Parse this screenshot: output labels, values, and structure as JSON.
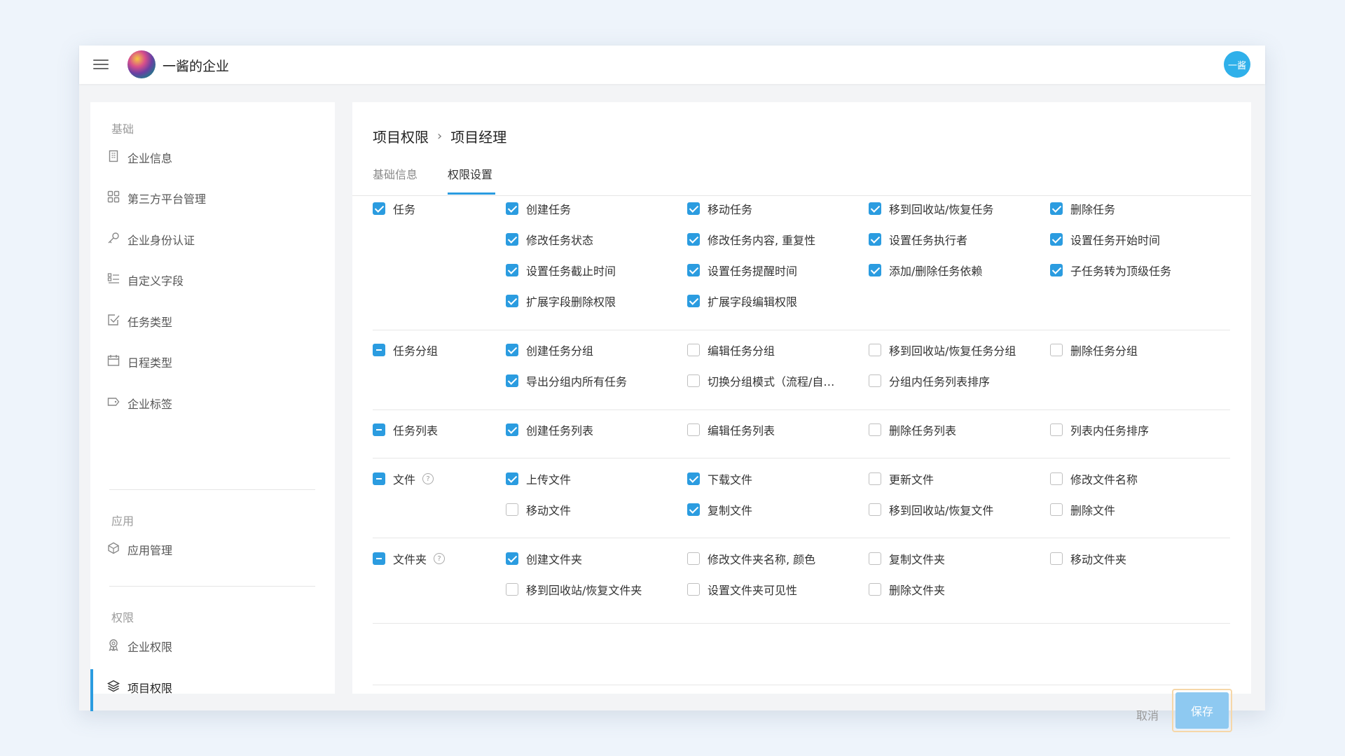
{
  "header": {
    "company_name": "一酱的企业",
    "avatar_text": "一酱"
  },
  "sidebar": {
    "sections": [
      {
        "title": "基础",
        "items": [
          {
            "label": "企业信息",
            "icon": "building-icon"
          },
          {
            "label": "第三方平台管理",
            "icon": "grid-icon"
          },
          {
            "label": "企业身份认证",
            "icon": "key-icon"
          },
          {
            "label": "自定义字段",
            "icon": "list-icon"
          },
          {
            "label": "任务类型",
            "icon": "checkbox-icon"
          },
          {
            "label": "日程类型",
            "icon": "calendar-icon"
          },
          {
            "label": "企业标签",
            "icon": "tag-icon"
          }
        ]
      },
      {
        "title": "应用",
        "items": [
          {
            "label": "应用管理",
            "icon": "cube-icon"
          }
        ]
      },
      {
        "title": "权限",
        "items": [
          {
            "label": "企业权限",
            "icon": "badge-icon"
          },
          {
            "label": "项目权限",
            "icon": "layers-icon",
            "active": true
          }
        ]
      }
    ]
  },
  "main": {
    "breadcrumb": [
      "项目权限",
      "项目经理"
    ],
    "tabs": [
      {
        "label": "基础信息",
        "active": false
      },
      {
        "label": "权限设置",
        "active": true
      }
    ],
    "groups": [
      {
        "name": "任务",
        "state": "checked",
        "help": false,
        "items": [
          {
            "label": "创建任务",
            "checked": true
          },
          {
            "label": "移动任务",
            "checked": true
          },
          {
            "label": "移到回收站/恢复任务",
            "checked": true
          },
          {
            "label": "删除任务",
            "checked": true
          },
          {
            "label": "修改任务状态",
            "checked": true
          },
          {
            "label": "修改任务内容, 重复性",
            "checked": true
          },
          {
            "label": "设置任务执行者",
            "checked": true
          },
          {
            "label": "设置任务开始时间",
            "checked": true
          },
          {
            "label": "设置任务截止时间",
            "checked": true
          },
          {
            "label": "设置任务提醒时间",
            "checked": true
          },
          {
            "label": "添加/删除任务依赖",
            "checked": true
          },
          {
            "label": "子任务转为顶级任务",
            "checked": true
          },
          {
            "label": "扩展字段删除权限",
            "checked": true
          },
          {
            "label": "扩展字段编辑权限",
            "checked": true
          }
        ]
      },
      {
        "name": "任务分组",
        "state": "indeterminate",
        "help": false,
        "items": [
          {
            "label": "创建任务分组",
            "checked": true
          },
          {
            "label": "编辑任务分组",
            "checked": false
          },
          {
            "label": "移到回收站/恢复任务分组",
            "checked": false
          },
          {
            "label": "删除任务分组",
            "checked": false
          },
          {
            "label": "导出分组内所有任务",
            "checked": true
          },
          {
            "label": "切换分组模式（流程/自…",
            "checked": false
          },
          {
            "label": "分组内任务列表排序",
            "checked": false
          }
        ]
      },
      {
        "name": "任务列表",
        "state": "indeterminate",
        "help": false,
        "items": [
          {
            "label": "创建任务列表",
            "checked": true
          },
          {
            "label": "编辑任务列表",
            "checked": false
          },
          {
            "label": "删除任务列表",
            "checked": false
          },
          {
            "label": "列表内任务排序",
            "checked": false
          }
        ]
      },
      {
        "name": "文件",
        "state": "indeterminate",
        "help": true,
        "items": [
          {
            "label": "上传文件",
            "checked": true
          },
          {
            "label": "下载文件",
            "checked": true
          },
          {
            "label": "更新文件",
            "checked": false
          },
          {
            "label": "修改文件名称",
            "checked": false
          },
          {
            "label": "移动文件",
            "checked": false
          },
          {
            "label": "复制文件",
            "checked": true
          },
          {
            "label": "移到回收站/恢复文件",
            "checked": false
          },
          {
            "label": "删除文件",
            "checked": false
          }
        ]
      },
      {
        "name": "文件夹",
        "state": "indeterminate",
        "help": true,
        "items": [
          {
            "label": "创建文件夹",
            "checked": true
          },
          {
            "label": "修改文件夹名称, 颜色",
            "checked": false
          },
          {
            "label": "复制文件夹",
            "checked": false
          },
          {
            "label": "移动文件夹",
            "checked": false
          },
          {
            "label": "移到回收站/恢复文件夹",
            "checked": false
          },
          {
            "label": "设置文件夹可见性",
            "checked": false
          },
          {
            "label": "删除文件夹",
            "checked": false
          }
        ]
      }
    ],
    "actions": {
      "cancel_label": "取消",
      "save_label": "保存"
    }
  },
  "colors": {
    "accent": "#2b9ce0",
    "save_button": "#8ec9f1",
    "avatar": "#2fb0ea"
  }
}
